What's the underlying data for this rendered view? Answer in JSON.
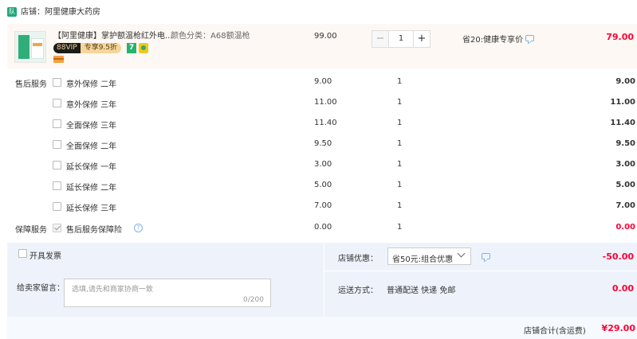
{
  "shop": {
    "logo_text": "队",
    "name": "店铺：阿里健康大药房"
  },
  "product": {
    "title": "【阿里健康】掌护额温枪红外电...",
    "spec": "颜色分类：A68额温枪",
    "vip_left": "88VIP",
    "vip_right": "专享9.5折",
    "badge_7": "7",
    "unit_price": "99.00",
    "quantity": "1",
    "minus": "−",
    "plus": "+",
    "saving": "省20:健康专享价",
    "total": "79.00"
  },
  "services": {
    "after_sales_label": "售后服务",
    "guarantee_label": "保障服务",
    "items": [
      {
        "name": "意外保修 二年",
        "price": "9.00",
        "qty": "1",
        "total": "9.00"
      },
      {
        "name": "意外保修 三年",
        "price": "11.00",
        "qty": "1",
        "total": "11.00"
      },
      {
        "name": "全面保修 三年",
        "price": "11.40",
        "qty": "1",
        "total": "11.40"
      },
      {
        "name": "全面保修 二年",
        "price": "9.50",
        "qty": "1",
        "total": "9.50"
      },
      {
        "name": "延长保修 一年",
        "price": "3.00",
        "qty": "1",
        "total": "3.00"
      },
      {
        "name": "延长保修 二年",
        "price": "5.00",
        "qty": "1",
        "total": "5.00"
      },
      {
        "name": "延长保修 三年",
        "price": "7.00",
        "qty": "1",
        "total": "7.00"
      }
    ],
    "guarantee": {
      "name": "售后服务保障险",
      "price": "0.00",
      "qty": "1",
      "total": "0.00",
      "help": "?"
    }
  },
  "invoice": {
    "label": "开具发票"
  },
  "message": {
    "label": "给卖家留言：",
    "placeholder": "选填,请先和商家协商一致",
    "count": "0/200"
  },
  "discount": {
    "label": "店铺优惠：",
    "selected": "省50元:组合优惠",
    "amount": "-50.00"
  },
  "shipping": {
    "label": "运送方式：",
    "value": "普通配送 快递 免邮",
    "amount": "0.00"
  },
  "footer": {
    "label": "店铺合计(含运费)",
    "amount": "¥29.00"
  },
  "colors": {
    "accent_red": "#ff0036",
    "bottom_bg": "#eef3fb",
    "product_bg": "#fdf8f3"
  }
}
